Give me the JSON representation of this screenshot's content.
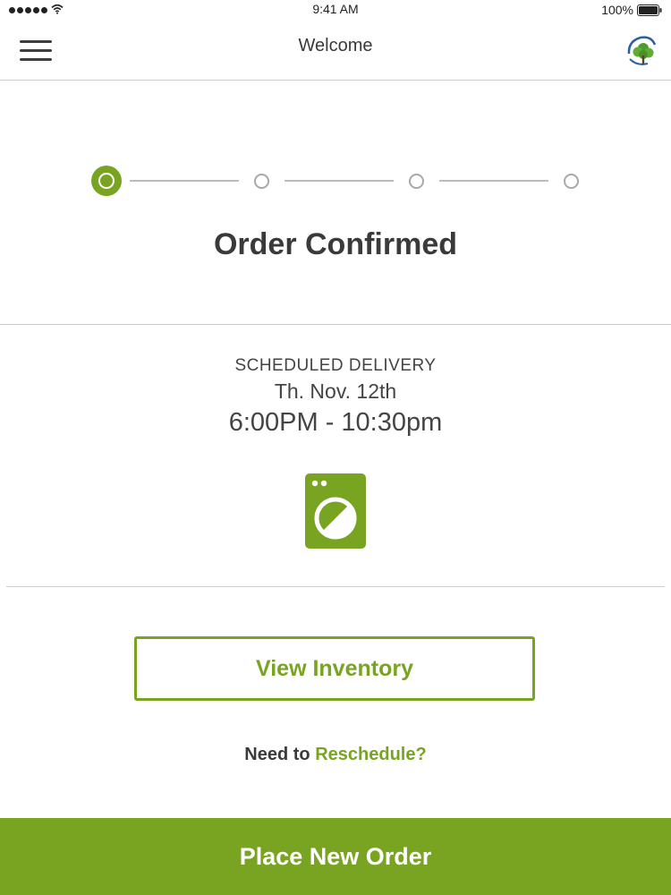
{
  "status_bar": {
    "time": "9:41 AM",
    "battery_percent": "100%",
    "signal_icon": "signal-dots-icon",
    "wifi_icon": "wifi-icon",
    "battery_icon": "battery-icon"
  },
  "nav": {
    "title": "Welcome",
    "menu_icon": "hamburger-menu-icon",
    "logo_icon": "tree-globe-logo"
  },
  "progress": {
    "total_steps": 4,
    "current_step": 1
  },
  "order": {
    "status": "Order Confirmed",
    "delivery_label": "SCHEDULED DELIVERY",
    "delivery_date": "Th. Nov. 12th",
    "delivery_window": "6:00PM - 10:30pm",
    "icon": "washing-machine-icon"
  },
  "actions": {
    "view_inventory": "View Inventory",
    "reschedule_prefix": "Need to",
    "reschedule_link": "Reschedule?",
    "place_new_order": "Place New Order"
  },
  "colors": {
    "accent": "#78a422",
    "text": "#3a3a3a",
    "divider": "#cdcdcd",
    "inactive_step": "#a8a8a8"
  }
}
